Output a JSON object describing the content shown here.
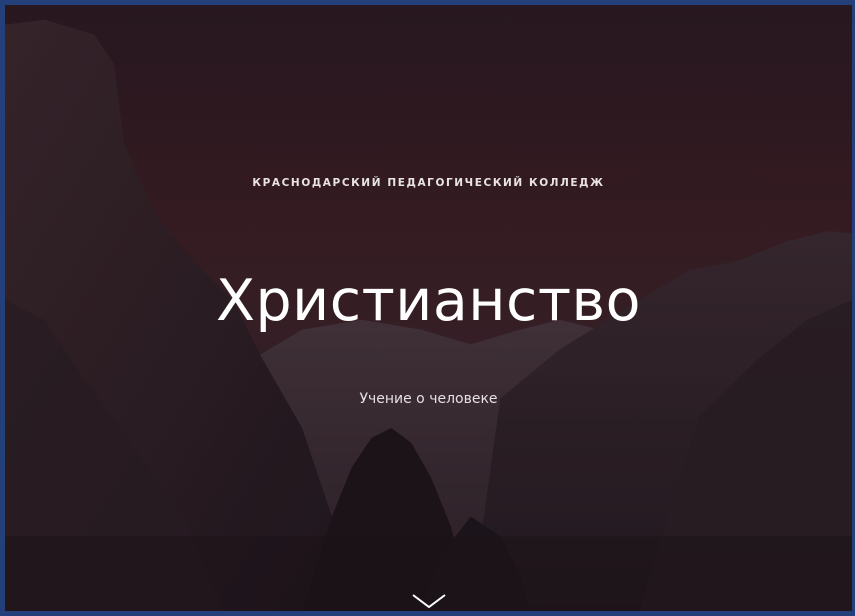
{
  "hero": {
    "kicker": "КРАСНОДАРСКИЙ ПЕДАГОГИЧЕСКИЙ КОЛЛЕДЖ",
    "title": "Христианство",
    "subtitle": "Учение о человеке",
    "background_image": "mountain-valley-at-dusk",
    "scroll_icon": "chevron-down-icon"
  },
  "colors": {
    "sky_top": "#2a1a22",
    "sky_mid": "#3a1f24",
    "text": "#ffffff",
    "frame": "#24407a"
  }
}
